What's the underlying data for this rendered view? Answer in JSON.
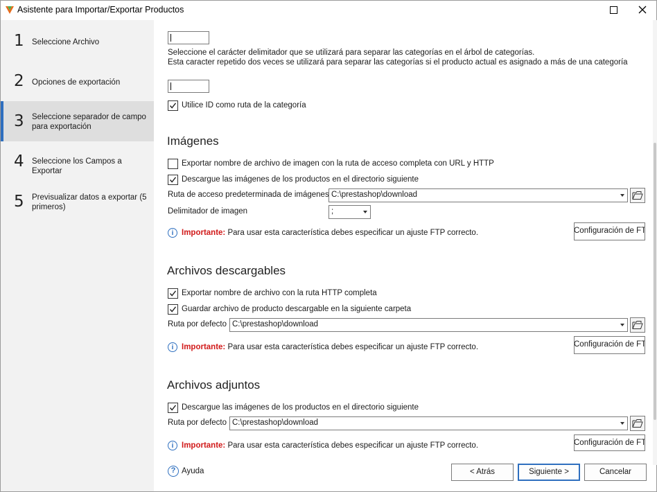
{
  "window": {
    "title": "Asistente para Importar/Exportar Productos"
  },
  "steps": [
    {
      "num": "1",
      "label": "Seleccione Archivo"
    },
    {
      "num": "2",
      "label": "Opciones de exportación"
    },
    {
      "num": "3",
      "label": "Seleccione separador de campo para exportación"
    },
    {
      "num": "4",
      "label": "Seleccione los Campos a Exportar"
    },
    {
      "num": "5",
      "label": "Previsualizar datos a exportar (5 primeros)"
    }
  ],
  "category": {
    "input1_value": "|",
    "desc_line1": "Seleccione el carácter delimitador que se utilizará para separar las categorías en el árbol de categorías.",
    "desc_line2": "Esta caracter repetido dos veces se utilizará para separar las categorías si el producto actual es asignado a más de una categoría",
    "input2_value": "|",
    "use_id_label": "Utilice ID como ruta de la categoría",
    "use_id_checked": true
  },
  "images": {
    "title": "Imágenes",
    "export_full_url_label": "Exportar nombre de archivo de imagen con la ruta de acceso completa con URL y HTTP",
    "export_full_url_checked": false,
    "download_label": "Descargue las imágenes de los productos en el directorio siguiente",
    "download_checked": true,
    "path_label": "Ruta de acceso predeterminada de imágenes",
    "path_value": "C:\\prestashop\\download",
    "delimiter_label": "Delimitador de imagen",
    "delimiter_value": ";",
    "important_label": "Importante:",
    "important_text": "Para usar esta característica debes especificar un ajuste FTP correcto.",
    "ftp_button": "Configuración de FTP"
  },
  "downloads": {
    "title": "Archivos descargables",
    "export_http_label": "Exportar nombre de archivo con la ruta HTTP completa",
    "export_http_checked": true,
    "save_label": "Guardar archivo de producto descargable en la siguiente carpeta",
    "save_checked": true,
    "path_label": "Ruta por defecto",
    "path_value": "C:\\prestashop\\download",
    "important_label": "Importante:",
    "important_text": "Para usar esta característica debes especificar un ajuste FTP correcto.",
    "ftp_button": "Configuración de FTP"
  },
  "attachments": {
    "title": "Archivos adjuntos",
    "download_label": "Descargue las imágenes de los productos en el directorio siguiente",
    "download_checked": true,
    "path_label": "Ruta por defecto",
    "path_value": "C:\\prestashop\\download",
    "important_label": "Importante:",
    "important_text": "Para usar esta característica debes especificar un ajuste FTP correcto.",
    "ftp_button": "Configuración de FTP"
  },
  "footer": {
    "help": "Ayuda",
    "back": "< Atrás",
    "next": "Siguiente >",
    "cancel": "Cancelar"
  },
  "colors": {
    "accent": "#2e6fbf",
    "important": "#d11a1a",
    "sidebar_bg": "#f2f2f2",
    "active_step_bg": "#dedede"
  }
}
